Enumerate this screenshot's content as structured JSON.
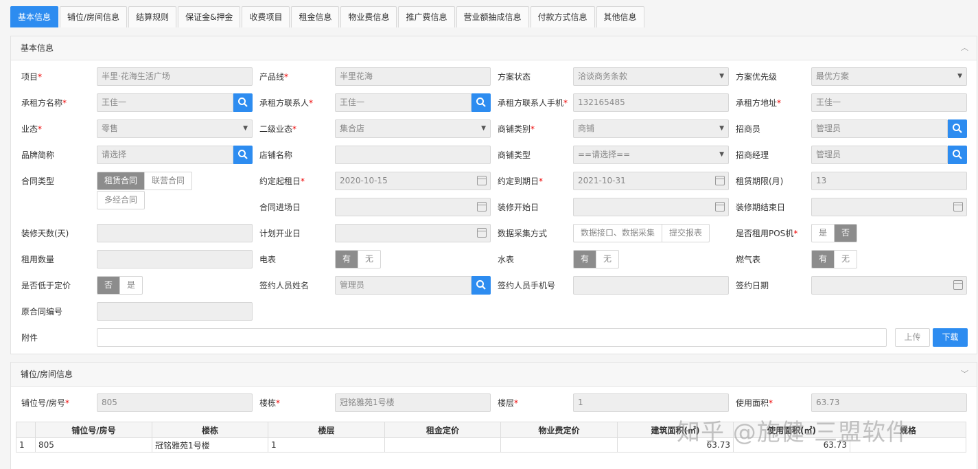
{
  "tabs": [
    "基本信息",
    "铺位/房间信息",
    "结算规则",
    "保证金&押金",
    "收费项目",
    "租金信息",
    "物业费信息",
    "推广费信息",
    "营业额抽成信息",
    "付款方式信息",
    "其他信息"
  ],
  "basic": {
    "title": "基本信息",
    "project_label": "项目",
    "project_value": "半里·花海生活广场",
    "product_line_label": "产品线",
    "product_line_value": "半里花海",
    "plan_status_label": "方案状态",
    "plan_status_value": "洽谈商务条款",
    "plan_priority_label": "方案优先级",
    "plan_priority_value": "最优方案",
    "tenant_name_label": "承租方名称",
    "tenant_name_value": "王佳一",
    "tenant_contact_label": "承租方联系人",
    "tenant_contact_value": "王佳一",
    "tenant_phone_label": "承租方联系人手机",
    "tenant_phone_value": "132165485",
    "tenant_address_label": "承租方地址",
    "tenant_address_value": "王佳一",
    "format_label": "业态",
    "format_value": "零售",
    "sub_format_label": "二级业态",
    "sub_format_value": "集合店",
    "shop_category_label": "商铺类别",
    "shop_category_value": "商铺",
    "leasing_agent_label": "招商员",
    "leasing_agent_value": "管理员",
    "brand_label": "品牌简称",
    "brand_placeholder": "请选择",
    "shop_name_label": "店铺名称",
    "shop_type_label": "商铺类型",
    "shop_type_value": "==请选择==",
    "leasing_manager_label": "招商经理",
    "leasing_manager_value": "管理员",
    "contract_type_label": "合同类型",
    "contract_types": [
      "租赁合同",
      "联营合同",
      "多经合同"
    ],
    "start_date_label": "约定起租日",
    "start_date_value": "2020-10-15",
    "end_date_label": "约定到期日",
    "end_date_value": "2021-10-31",
    "lease_months_label": "租赁期限(月)",
    "lease_months_value": "13",
    "entry_date_label": "合同进场日",
    "reno_start_label": "装修开始日",
    "reno_end_label": "装修期结束日",
    "reno_days_label": "装修天数(天)",
    "plan_open_label": "计划开业日",
    "data_collect_label": "数据采集方式",
    "data_collect_options": [
      "数据接口、数据采集",
      "提交报表"
    ],
    "pos_label": "是否租用POS机",
    "pos_options": [
      "是",
      "否"
    ],
    "rent_qty_label": "租用数量",
    "electric_label": "电表",
    "water_label": "水表",
    "gas_label": "燃气表",
    "meter_options": [
      "有",
      "无"
    ],
    "below_price_label": "是否低于定价",
    "below_price_options": [
      "否",
      "是"
    ],
    "signer_name_label": "签约人员姓名",
    "signer_name_value": "管理员",
    "signer_phone_label": "签约人员手机号",
    "sign_date_label": "签约日期",
    "orig_contract_label": "原合同编号",
    "attachment_label": "附件",
    "upload_label": "上传",
    "download_label": "下载"
  },
  "room": {
    "title": "铺位/房间信息",
    "room_no_label": "铺位号/房号",
    "room_no_value": "805",
    "building_label": "楼栋",
    "building_value": "冠铭雅苑1号楼",
    "floor_label": "楼层",
    "floor_value": "1",
    "area_label": "使用面积",
    "area_value": "63.73",
    "columns": [
      "铺位号/房号",
      "楼栋",
      "楼层",
      "租金定价",
      "物业费定价",
      "建筑面积(㎡)",
      "使用面积(㎡)",
      "规格"
    ],
    "rows": [
      {
        "idx": "1",
        "room": "805",
        "building": "冠铭雅苑1号楼",
        "floor": "1",
        "rent": "",
        "fee": "",
        "build_area": "63.73",
        "use_area": "63.73",
        "spec": ""
      }
    ]
  },
  "watermark": "知乎 @施健-三盟软件",
  "colors": {
    "primary": "#2d8cf0",
    "selected_segment": "#8c8c8c",
    "required": "#ee0000"
  }
}
